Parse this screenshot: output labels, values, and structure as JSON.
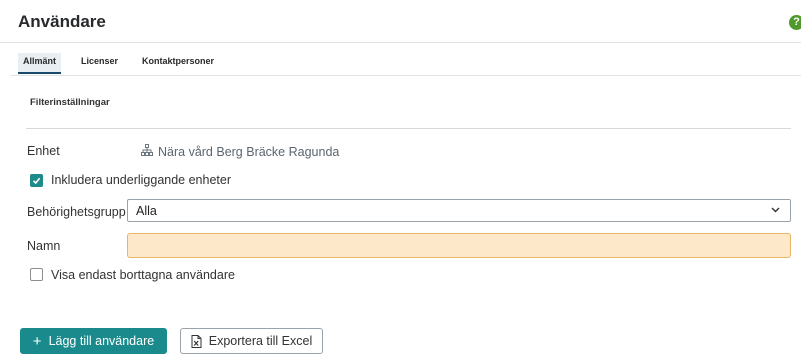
{
  "header": {
    "title": "Användare",
    "help_icon": "?"
  },
  "tabs": [
    {
      "label": "Allmänt",
      "active": true
    },
    {
      "label": "Licenser",
      "active": false
    },
    {
      "label": "Kontaktpersoner",
      "active": false
    }
  ],
  "filter": {
    "section_title": "Filterinställningar",
    "unit": {
      "label": "Enhet",
      "value": "Nära vård Berg Bräcke Ragunda",
      "icon": "org-tree-icon"
    },
    "include_sub_units": {
      "label": "Inkludera underliggande enheter",
      "checked": true
    },
    "permission_group": {
      "label": "Behörighetsgrupp",
      "selected": "Alla"
    },
    "name": {
      "label": "Namn",
      "value": ""
    },
    "show_deleted": {
      "label": "Visa endast borttagna användare",
      "checked": false
    }
  },
  "actions": {
    "add_user": "Lägg till användare",
    "export_excel": "Exportera till Excel"
  },
  "colors": {
    "accent": "#1b8a8c",
    "highlight_input": "#fde8c9",
    "help_icon": "#4f9a2d"
  }
}
